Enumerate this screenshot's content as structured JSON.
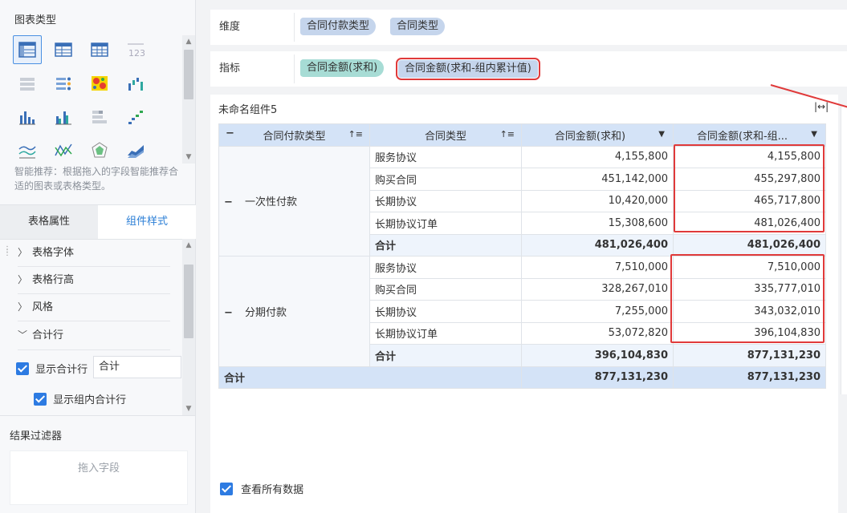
{
  "left": {
    "chart_type_title": "图表类型",
    "hint": "智能推荐：根据拖入的字段智能推荐合适的图表或表格类型。",
    "tabs": {
      "props": "表格属性",
      "style": "组件样式"
    },
    "accordion": [
      "表格字体",
      "表格行高",
      "风格",
      "合计行"
    ],
    "show_total_row": "显示合计行",
    "total_input_value": "合计",
    "show_group_total_row": "显示组内合计行",
    "filter_title": "结果过滤器",
    "drop_zone": "拖入字段",
    "colors": {
      "accent": "#2d7be2"
    }
  },
  "fields": {
    "dimension_label": "维度",
    "dimensions": [
      "合同付款类型",
      "合同类型"
    ],
    "measure_label": "指标",
    "measures": [
      "合同金额(求和)",
      "合同金额(求和-组内累计值)"
    ]
  },
  "component": {
    "title": "未命名组件5",
    "show_all_data": "查看所有数据"
  },
  "table": {
    "headers": [
      "合同付款类型",
      "合同类型",
      "合同金额(求和)",
      "合同金额(求和-组..."
    ],
    "groups": [
      {
        "name": "一次性付款",
        "rows": [
          [
            "服务协议",
            "4,155,800",
            "4,155,800"
          ],
          [
            "购买合同",
            "451,142,000",
            "455,297,800"
          ],
          [
            "长期协议",
            "10,420,000",
            "465,717,800"
          ],
          [
            "长期协议订单",
            "15,308,600",
            "481,026,400"
          ]
        ],
        "subtotal": [
          "合计",
          "481,026,400",
          "481,026,400"
        ]
      },
      {
        "name": "分期付款",
        "rows": [
          [
            "服务协议",
            "7,510,000",
            "7,510,000"
          ],
          [
            "购买合同",
            "328,267,010",
            "335,777,010"
          ],
          [
            "长期协议",
            "7,255,000",
            "343,032,010"
          ],
          [
            "长期协议订单",
            "53,072,820",
            "396,104,830"
          ]
        ],
        "subtotal": [
          "合计",
          "396,104,830",
          "877,131,230"
        ]
      }
    ],
    "grand_total": [
      "合计",
      "877,131,230",
      "877,131,230"
    ]
  }
}
